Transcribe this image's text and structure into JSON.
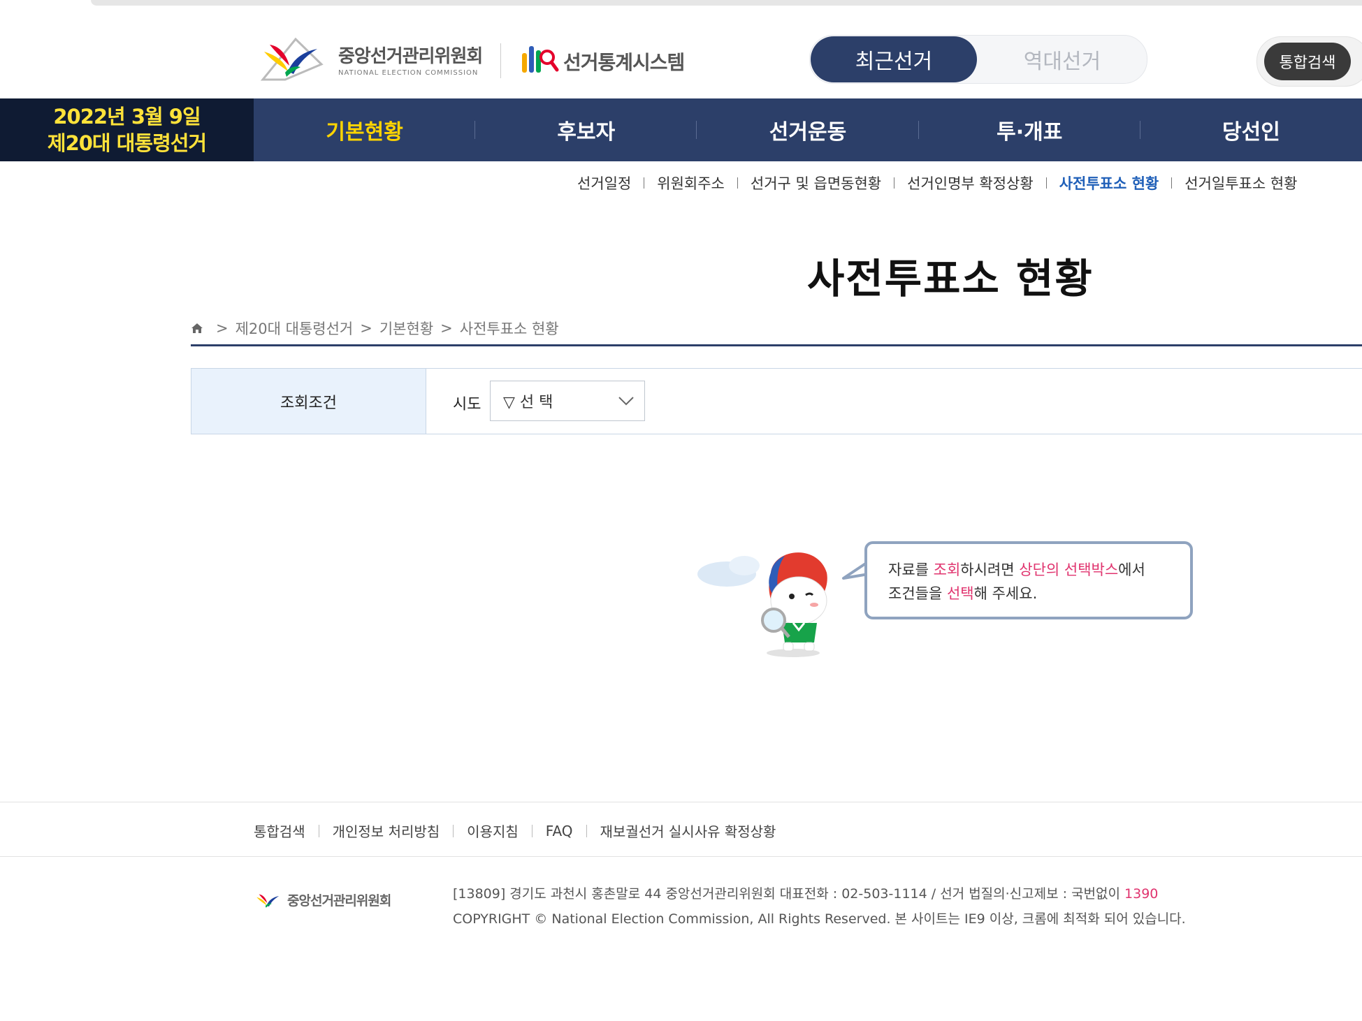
{
  "header": {
    "nec_name_ko": "중앙선거관리위원회",
    "nec_name_en": "NATIONAL ELECTION COMMISSION",
    "system_name": "선거통계시스템",
    "toggle": {
      "recent": "최근선거",
      "past": "역대선거"
    },
    "search_button": "통합검색"
  },
  "election": {
    "date": "2022년 3월 9일",
    "name": "제20대 대통령선거"
  },
  "nav": {
    "items": [
      {
        "label": "기본현황",
        "active": true
      },
      {
        "label": "후보자"
      },
      {
        "label": "선거운동"
      },
      {
        "label": "투·개표"
      },
      {
        "label": "당선인"
      }
    ]
  },
  "submenu": {
    "items": [
      {
        "label": "선거일정"
      },
      {
        "label": "위원회주소"
      },
      {
        "label": "선거구 및 읍면동현황"
      },
      {
        "label": "선거인명부 확정상황"
      },
      {
        "label": "사전투표소 현황",
        "active": true
      },
      {
        "label": "선거일투표소 현황"
      }
    ]
  },
  "page": {
    "title": "사전투표소 현황"
  },
  "breadcrumb": {
    "items": [
      "제20대 대통령선거",
      "기본현황",
      "사전투표소 현황"
    ]
  },
  "query": {
    "label": "조회조건",
    "sido_label": "시도",
    "sido_select": "▽ 선 택"
  },
  "notice": {
    "part1": "자료를 ",
    "part2": "조회",
    "part3": "하시려면 ",
    "part4": "상단의 선택박스",
    "part5": "에서",
    "part6": "조건들을 ",
    "part7": "선택",
    "part8": "해 주세요."
  },
  "footer": {
    "links": [
      "통합검색",
      "개인정보 처리방침",
      "이용지침",
      "FAQ",
      "재보궐선거 실시사유 확정상황"
    ],
    "logo_text": "중앙선거관리위원회",
    "address": "[13809] 경기도 과천시 홍촌말로 44 중앙선거관리위원회 대표전화 : 02-503-1114 / 선거 법질의·신고제보 : 국번없이 ",
    "hotline": "1390",
    "copyright": "COPYRIGHT © National Election Commission, All Rights Reserved. 본 사이트는 IE9 이상, 크롬에 최적화 되어 있습니다."
  },
  "colors": {
    "navy": "#2c3f69",
    "dark_navy": "#0f1b33",
    "active_yellow": "#ffd400",
    "submenu_active": "#1f5fb8",
    "highlight_pink": "#e0336e"
  }
}
